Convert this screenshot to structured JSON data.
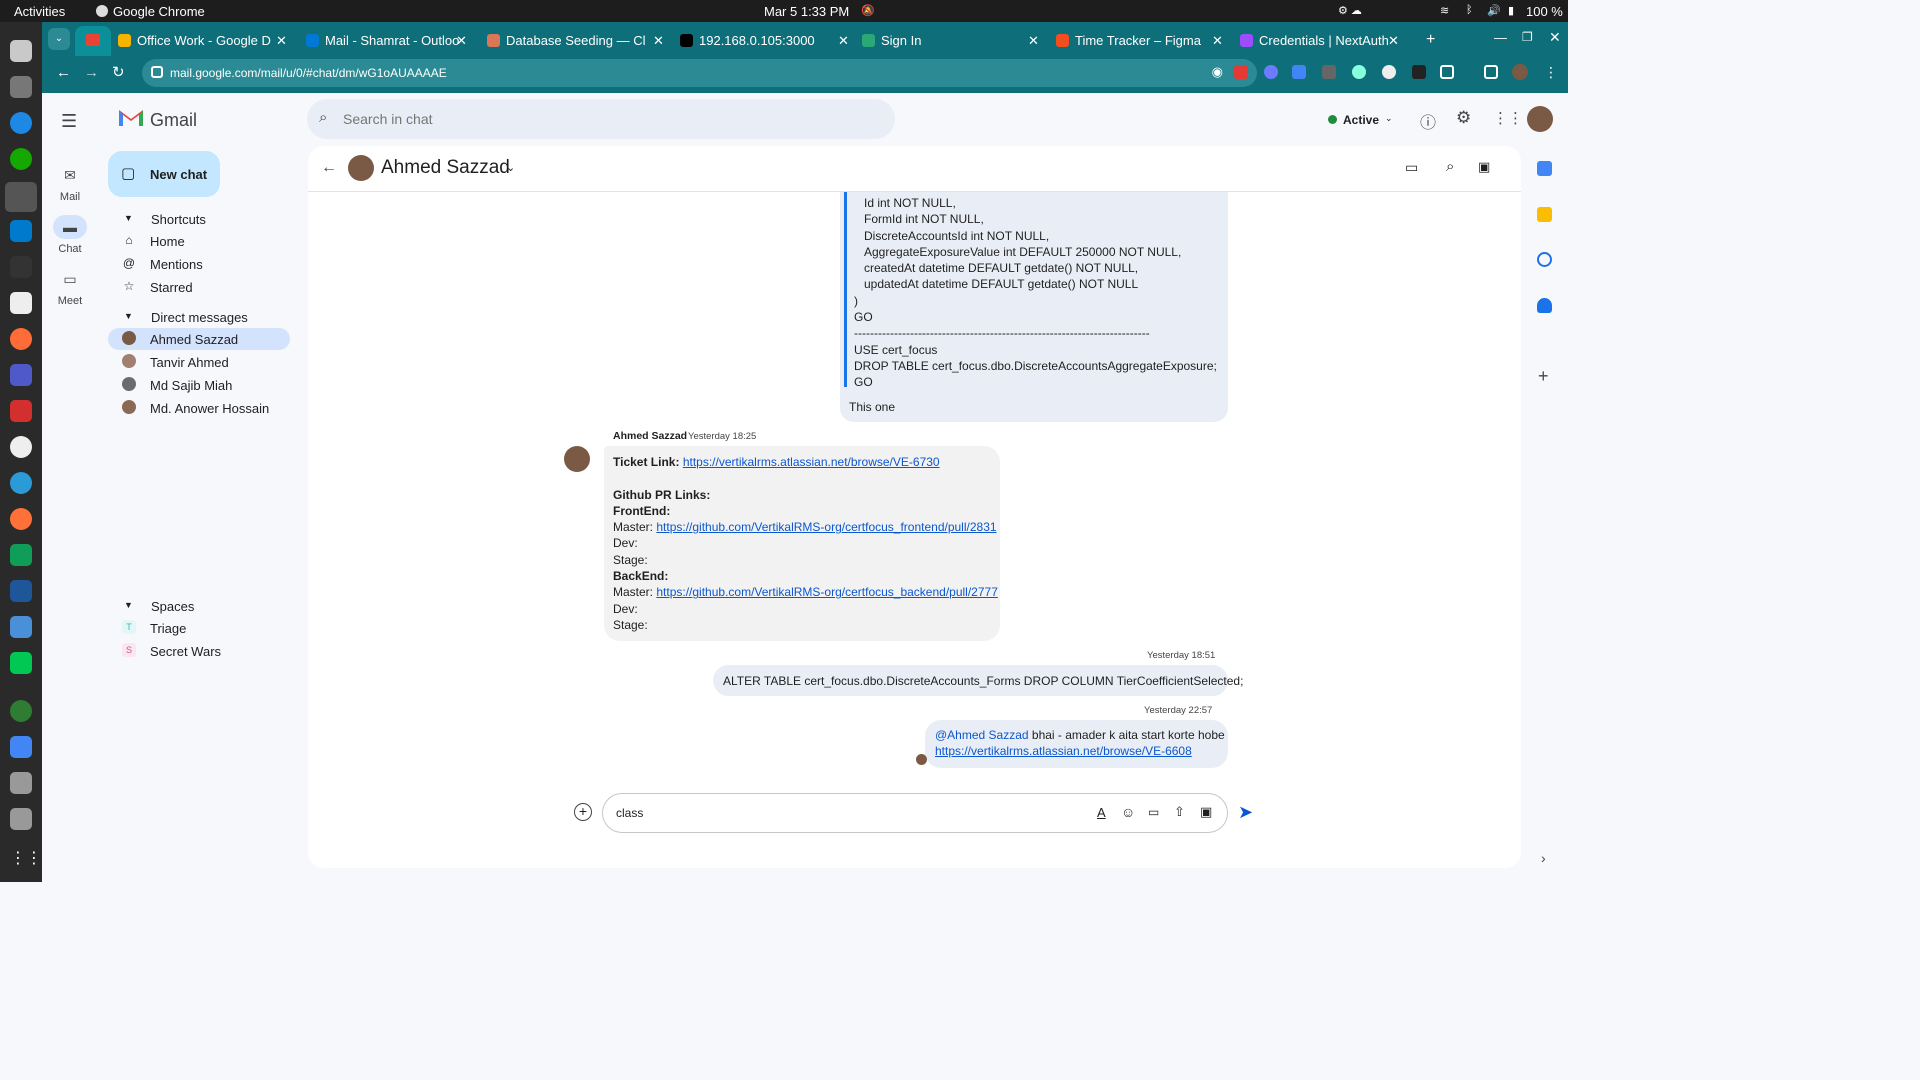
{
  "system": {
    "activities": "Activities",
    "app": "Google Chrome",
    "datetime": "Mar 5  1:33 PM",
    "battery": "100 %"
  },
  "tabs": [
    {
      "title": "Office Work - Google D",
      "color": "#f4b400"
    },
    {
      "title": "Mail - Shamrat - Outloo",
      "color": "#0078d4"
    },
    {
      "title": "Database Seeding — Cl",
      "color": "#d97757"
    },
    {
      "title": "192.168.0.105:3000",
      "color": "#000000"
    },
    {
      "title": "Sign In",
      "color": "#2aa876"
    },
    {
      "title": "Time Tracker – Figma",
      "color": "#f24e1e"
    },
    {
      "title": "Credentials | NextAuth",
      "color": "#9b4dff"
    }
  ],
  "omnibox": {
    "url": "mail.google.com/mail/u/0/#chat/dm/wG1oAUAAAAE"
  },
  "gmail": {
    "title": "Gmail",
    "search_placeholder": "Search in chat",
    "status": "Active"
  },
  "rail": [
    {
      "label": "Mail"
    },
    {
      "label": "Chat"
    },
    {
      "label": "Meet"
    }
  ],
  "nav": {
    "new_chat": "New chat",
    "shortcuts_header": "Shortcuts",
    "shortcuts": [
      "Home",
      "Mentions",
      "Starred"
    ],
    "dm_header": "Direct messages",
    "dms": [
      "Ahmed Sazzad",
      "Tanvir Ahmed",
      "Md Sajib Miah",
      "Md. Anower Hossain"
    ],
    "spaces_header": "Spaces",
    "spaces": [
      {
        "initial": "T",
        "name": "Triage"
      },
      {
        "initial": "S",
        "name": "Secret Wars"
      }
    ]
  },
  "chat": {
    "contact": "Ahmed Sazzad",
    "quoted_lines": [
      "Id int NOT NULL,",
      "FormId int NOT NULL,",
      "DiscreteAccountsId int NOT NULL,",
      "AggregateExposureValue int DEFAULT 250000 NOT NULL,",
      "createdAt datetime DEFAULT getdate() NOT NULL,",
      "updatedAt datetime DEFAULT getdate() NOT NULL",
      ")",
      "GO",
      "--------------------------------------------------------------------------",
      "USE cert_focus",
      "DROP TABLE cert_focus.dbo.DiscreteAccountsAggregateExposure;",
      "GO"
    ],
    "this_one": "This one",
    "msg1_sender": "Ahmed Sazzad",
    "msg1_time": "Yesterday 18:25",
    "ticket_label": "Ticket Link:",
    "ticket_url": "https://vertikalrms.atlassian.net/browse/VE-6730",
    "pr_header": "Github PR Links:",
    "frontend_label": "FrontEnd:",
    "master_label": "Master:",
    "frontend_master_url": "https://github.com/VertikalRMS-org/certfocus_frontend/pull/2831",
    "dev_label": "Dev:",
    "stage_label": "Stage:",
    "backend_label": "BackEnd:",
    "backend_master_url": "https://github.com/VertikalRMS-org/certfocus_backend/pull/2777",
    "msg2_time": "Yesterday 18:51",
    "msg2_text": "ALTER TABLE cert_focus.dbo.DiscreteAccounts_Forms DROP COLUMN TierCoefficientSelected;",
    "msg3_time": "Yesterday 22:57",
    "msg3_mention": "@Ahmed Sazzad",
    "msg3_text": " bhai - amader k aita start korte hobe",
    "msg3_url": "https://vertikalrms.atlassian.net/browse/VE-6608",
    "composer_value": "class"
  }
}
